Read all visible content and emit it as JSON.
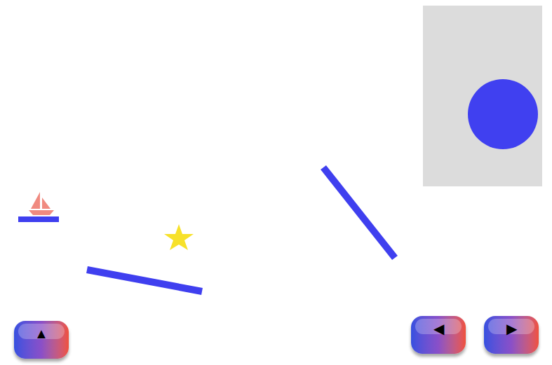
{
  "controls": [
    {
      "label": "▲"
    },
    {
      "label": "◀"
    },
    {
      "label": "▶"
    }
  ]
}
